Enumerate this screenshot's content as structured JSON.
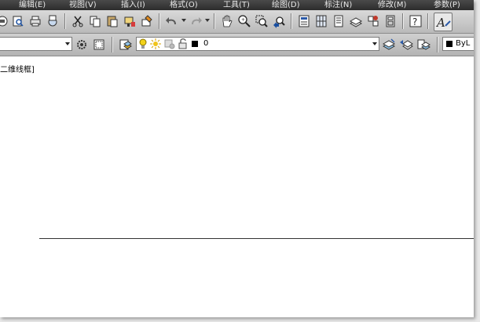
{
  "menubar": {
    "items": [
      "编辑(E)",
      "视图(V)",
      "插入(I)",
      "格式(O)",
      "工具(T)",
      "绘图(D)",
      "标注(N)",
      "修改(M)",
      "参数(P)"
    ]
  },
  "toolbar2": {
    "workspace_combo": "",
    "layer_combo_value": "0",
    "color_combo_value": "ByL"
  },
  "canvas": {
    "viewport_label": "二维线框]"
  },
  "colors": {
    "menubar": "#333333",
    "toolbar": "#c8c8c8",
    "canvas": "#ffffff",
    "bulb": "#f2d21b",
    "sun": "#f0c419"
  },
  "icons": {
    "toolbar1": [
      "open-icon",
      "preview-icon",
      "plot-icon",
      "publish-icon",
      "cut-icon",
      "copy-icon",
      "paste-icon",
      "match-properties-icon",
      "block-editor-icon",
      "undo-icon",
      "redo-icon",
      "pan-icon",
      "zoom-realtime-icon",
      "zoom-window-icon",
      "zoom-previous-icon",
      "properties-icon",
      "design-center-icon",
      "tool-palettes-icon",
      "sheet-set-icon",
      "markup-icon",
      "calculator-icon",
      "help-icon",
      "text-style-icon"
    ],
    "toolbar2": [
      "workspace-settings-icon",
      "customize-icon",
      "layer-manager-icon",
      "lightbulb-icon",
      "sun-icon",
      "freeze-viewport-icon",
      "lock-icon",
      "color-swatch-icon",
      "make-current-layer-icon",
      "layer-previous-icon",
      "layer-states-icon"
    ]
  }
}
